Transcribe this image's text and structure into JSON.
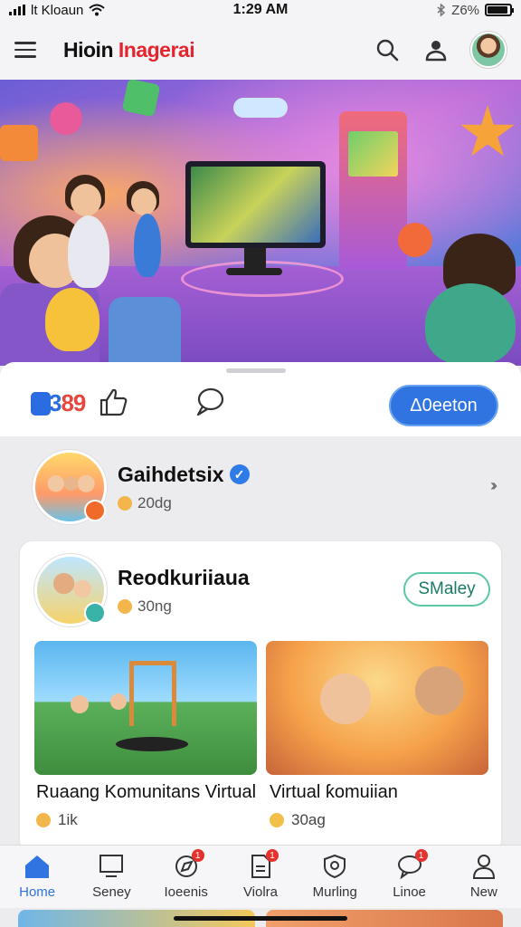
{
  "status_bar": {
    "carrier": "lt Kloaun",
    "time": "1:29 AM",
    "battery": "Z6%",
    "battery_level": 0.9
  },
  "header": {
    "title_part1": "Hioin",
    "title_part2": "Inagerai",
    "icons": [
      "menu-icon",
      "search-icon",
      "person-icon"
    ]
  },
  "hero": {
    "description_icons": [
      "arcade-machine",
      "monitor",
      "star"
    ]
  },
  "actions": {
    "reaction_count_a": "3",
    "reaction_count_b": "89",
    "primary_button": "Δ0eeton"
  },
  "group": {
    "title": "Gaihdetsix",
    "meta": "20dg"
  },
  "post": {
    "author": "Reodkuriiaua",
    "meta": "30ng",
    "follow_button": "SMaley",
    "items": [
      {
        "caption": "Ruaang Komunitans Virtual",
        "meta": "1ik"
      },
      {
        "caption": "Virtual ƙomuiian",
        "meta": "30ag"
      }
    ]
  },
  "nav": {
    "items": [
      {
        "label": "Home",
        "active": true,
        "badge": ""
      },
      {
        "label": "Seney",
        "active": false,
        "badge": ""
      },
      {
        "label": "Ioeenis",
        "active": false,
        "badge": "1"
      },
      {
        "label": "Violra",
        "active": false,
        "badge": "1"
      },
      {
        "label": "Murling",
        "active": false,
        "badge": ""
      },
      {
        "label": "Linoe",
        "active": false,
        "badge": "1"
      },
      {
        "label": "Νew",
        "active": false,
        "badge": ""
      }
    ]
  },
  "colors": {
    "accent": "#2f74e0",
    "brand_red": "#e4252d",
    "follow": "#5cc7a6",
    "badge": "#e5322d"
  }
}
